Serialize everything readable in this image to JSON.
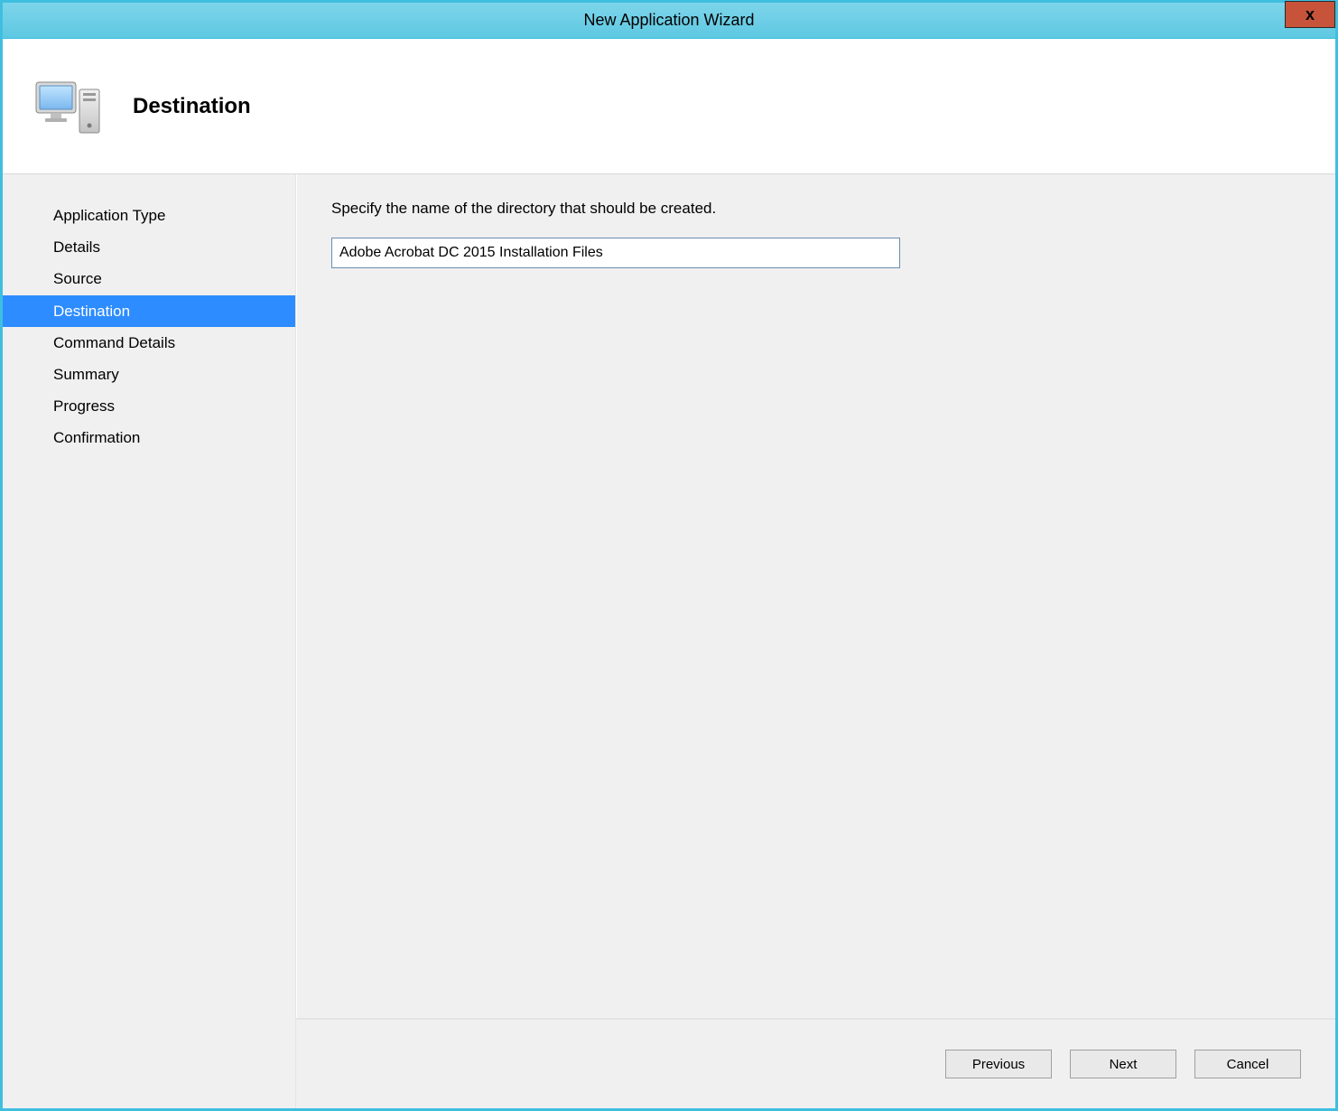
{
  "window": {
    "title": "New Application Wizard",
    "close_label": "x"
  },
  "header": {
    "title": "Destination"
  },
  "sidebar": {
    "items": [
      {
        "label": "Application Type",
        "selected": false
      },
      {
        "label": "Details",
        "selected": false
      },
      {
        "label": "Source",
        "selected": false
      },
      {
        "label": "Destination",
        "selected": true
      },
      {
        "label": "Command Details",
        "selected": false
      },
      {
        "label": "Summary",
        "selected": false
      },
      {
        "label": "Progress",
        "selected": false
      },
      {
        "label": "Confirmation",
        "selected": false
      }
    ]
  },
  "main": {
    "instruction": "Specify the name of the directory that should be created.",
    "directory_value": "Adobe Acrobat DC 2015 Installation Files"
  },
  "footer": {
    "previous_label": "Previous",
    "next_label": "Next",
    "cancel_label": "Cancel"
  }
}
